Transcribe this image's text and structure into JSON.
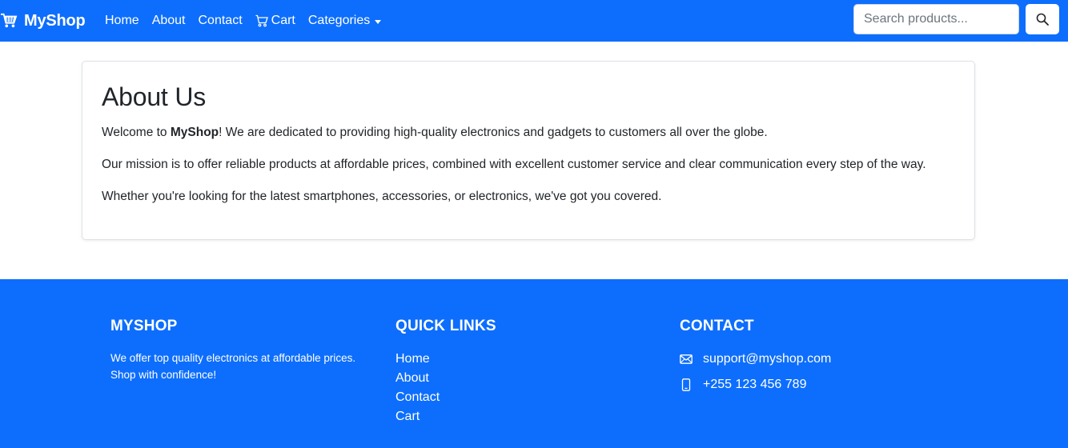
{
  "navbar": {
    "brand": "MyShop",
    "links": [
      "Home",
      "About",
      "Contact"
    ],
    "cart_label": "Cart",
    "categories_label": "Categories",
    "search_placeholder": "Search products...",
    "accent_color": "#0d6efd"
  },
  "about": {
    "title": "About Us",
    "p1_prefix": "Welcome to ",
    "p1_bold": "MyShop",
    "p1_suffix": "! We are dedicated to providing high-quality electronics and gadgets to customers all over the globe.",
    "p2": "Our mission is to offer reliable products at affordable prices, combined with excellent customer service and clear communication every step of the way.",
    "p3": "Whether you're looking for the latest smartphones, accessories, or electronics, we've got you covered."
  },
  "footer": {
    "brand_heading": "MyShop",
    "brand_desc": "We offer top quality electronics at affordable prices. Shop with confidence!",
    "quick_links_heading": "Quick Links",
    "quick_links": [
      "Home",
      "About",
      "Contact",
      "Cart"
    ],
    "contact_heading": "Contact",
    "email": "support@myshop.com",
    "phone": "+255 123 456 789"
  },
  "icons": [
    "cart-icon",
    "search-icon",
    "envelope-icon",
    "phone-icon"
  ]
}
